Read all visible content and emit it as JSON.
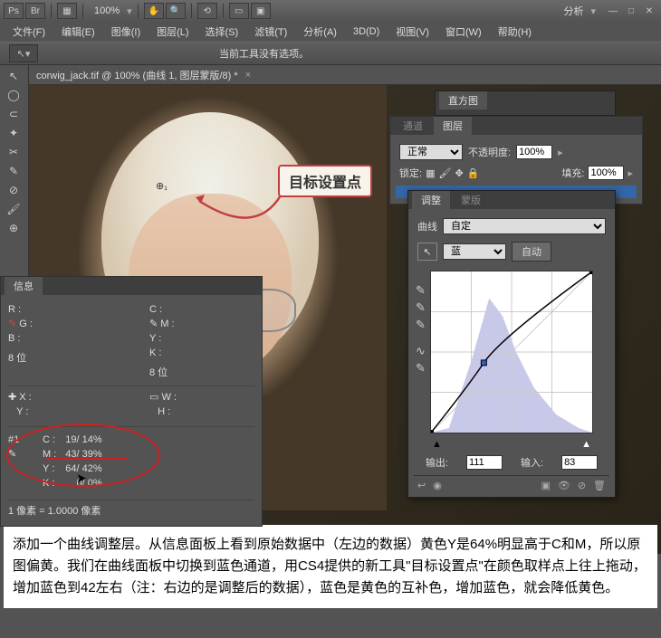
{
  "titlebar": {
    "zoom": "100%",
    "workspace_menu": "分析"
  },
  "menu": [
    "文件(F)",
    "编辑(E)",
    "图像(I)",
    "图层(L)",
    "选择(S)",
    "滤镜(T)",
    "分析(A)",
    "3D(D)",
    "视图(V)",
    "窗口(W)",
    "帮助(H)"
  ],
  "optbar": {
    "msg": "当前工具没有选项。"
  },
  "doc_tab": {
    "title": "corwig_jack.tif @ 100% (曲线 1, 图层蒙版/8) *"
  },
  "callout": "目标设置点",
  "sample_marker": "⊕₁",
  "panels": {
    "histogram": "直方图",
    "channels": "通道",
    "layers": "图层",
    "blend_mode": "正常",
    "opacity_label": "不透明度:",
    "opacity": "100%",
    "lock_label": "锁定:",
    "fill_label": "填充:",
    "fill": "100%",
    "adj_tab": "调整",
    "mask_tab": "蒙版",
    "curve_label": "曲线",
    "preset": "自定",
    "channel": "蓝",
    "auto": "自动",
    "output_label": "输出:",
    "output": "111",
    "input_label": "输入:",
    "input": "83"
  },
  "info": {
    "title": "信息",
    "rgb": {
      "R": "R :",
      "G": "G :",
      "B": "B :"
    },
    "cmyk": {
      "C": "C :",
      "M": "M :",
      "Y": "Y :",
      "K": "K :"
    },
    "bit": "8 位",
    "bit2": "8 位",
    "xy": {
      "X": "X :",
      "Y": "Y :"
    },
    "wh": {
      "W": "W :",
      "H": "H :"
    },
    "sample": {
      "num": "#1",
      "C": "C :",
      "M": "M :",
      "Y": "Y :",
      "K": "K :",
      "c_val": "19/  14%",
      "m_val": "43/  39%",
      "y_val": "64/  42%",
      "k_val": "0/    0%"
    },
    "footer": "1 像素 = 1.0000 像素"
  },
  "caption": "添加一个曲线调整层。从信息面板上看到原始数据中（左边的数据）黄色Y是64%明显高于C和M，所以原图偏黄。我们在曲线面板中切换到蓝色通道，用CS4提供的新工具\"目标设置点\"在颜色取样点上往上拖动，增加蓝色到42左右（注：右边的是调整后的数据），蓝色是黄色的互补色，增加蓝色，就会降低黄色。",
  "chart_data": {
    "type": "line",
    "title": "Curves - Blue channel",
    "xlabel": "Input",
    "ylabel": "Output",
    "xlim": [
      0,
      255
    ],
    "ylim": [
      0,
      255
    ],
    "control_points": [
      {
        "x": 0,
        "y": 0
      },
      {
        "x": 83,
        "y": 111
      },
      {
        "x": 255,
        "y": 255
      }
    ],
    "histogram_peak_x": 90
  }
}
